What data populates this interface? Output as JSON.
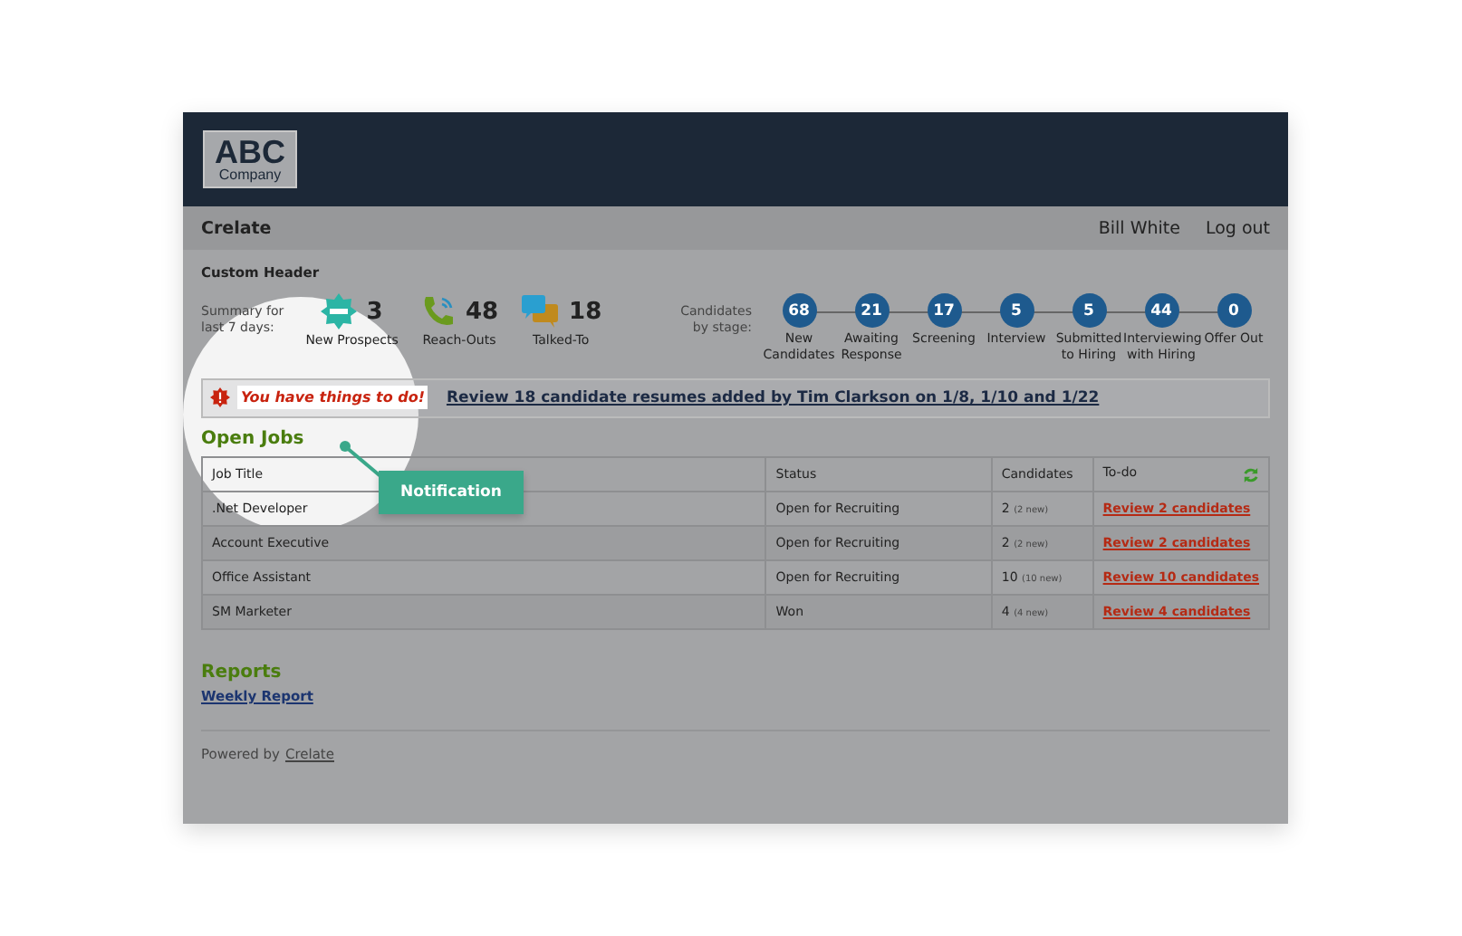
{
  "logo": {
    "name": "ABC",
    "sub": "Company"
  },
  "topbar": {
    "app": "Crelate",
    "user": "Bill White",
    "logout": "Log out"
  },
  "custom_header": "Custom Header",
  "summary": {
    "label_line1": "Summary for",
    "label_line2": "last 7 days:",
    "items": [
      {
        "kind": "new",
        "count": "3",
        "label": "New Prospects"
      },
      {
        "kind": "phone",
        "count": "48",
        "label": "Reach-Outs"
      },
      {
        "kind": "chat",
        "count": "18",
        "label": "Talked-To"
      }
    ]
  },
  "stages": {
    "label_line1": "Candidates",
    "label_line2": "by stage:",
    "items": [
      {
        "count": "68",
        "label": "New Candidates"
      },
      {
        "count": "21",
        "label": "Awaiting Response"
      },
      {
        "count": "17",
        "label": "Screening"
      },
      {
        "count": "5",
        "label": "Interview"
      },
      {
        "count": "5",
        "label": "Submitted to Hiring"
      },
      {
        "count": "44",
        "label": "Interviewing with Hiring"
      },
      {
        "count": "0",
        "label": "Offer Out"
      }
    ]
  },
  "notification": {
    "alert": "You have things to do!",
    "link": "Review 18 candidate resumes added by Tim Clarkson on 1/8, 1/10 and 1/22"
  },
  "callout": "Notification",
  "open_jobs": {
    "title": "Open Jobs",
    "columns": [
      "Job Title",
      "Status",
      "Candidates",
      "To-do"
    ],
    "rows": [
      {
        "title": ".Net Developer",
        "status": "Open for Recruiting",
        "count": "2",
        "new": "(2 new)",
        "todo": "Review 2 candidates"
      },
      {
        "title": "Account Executive",
        "status": "Open for Recruiting",
        "count": "2",
        "new": "(2 new)",
        "todo": "Review 2 candidates"
      },
      {
        "title": "Office Assistant",
        "status": "Open for Recruiting",
        "count": "10",
        "new": "(10 new)",
        "todo": "Review 10 candidates"
      },
      {
        "title": "SM Marketer",
        "status": "Won",
        "count": "4",
        "new": "(4 new)",
        "todo": "Review 4 candidates"
      }
    ]
  },
  "reports": {
    "title": "Reports",
    "links": [
      "Weekly Report"
    ]
  },
  "footer": {
    "text": "Powered by",
    "link": "Crelate"
  }
}
